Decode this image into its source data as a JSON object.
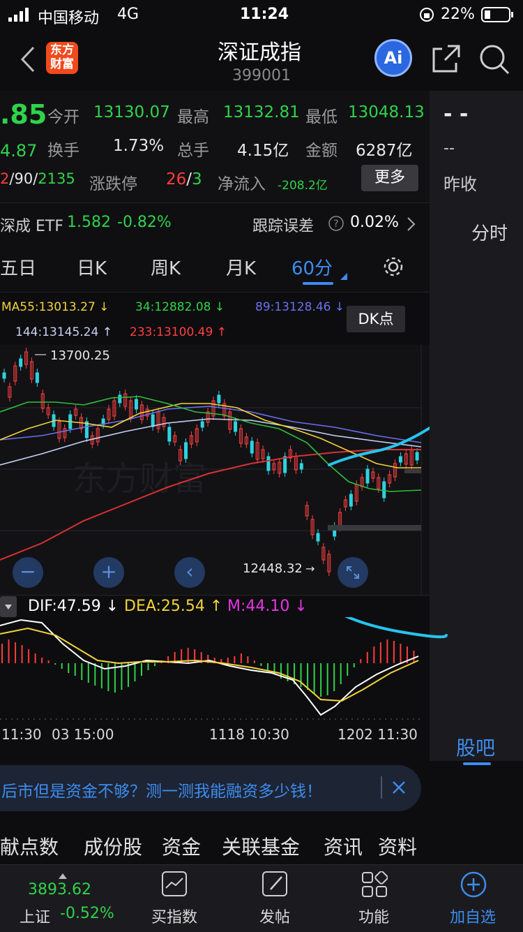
{
  "status_bar": {
    "carrier": "中国移动",
    "network": "4G",
    "time": "11:24",
    "battery": "22%"
  },
  "header": {
    "title": "深证成指",
    "code": "399001",
    "logo_text": "东方财富",
    "ai_label": "Ai"
  },
  "quote": {
    "price": ".85",
    "change": "4.87",
    "open_label": "今开",
    "open_value": "13130.07",
    "high_label": "最高",
    "high_value": "13132.81",
    "low_label": "最低",
    "low_value": "13048.13",
    "turnover_label": "换手",
    "turnover_value": "1.73%",
    "volume_label": "总手",
    "volume_value": "4.15亿",
    "amount_label": "金额",
    "amount_value": "6287亿",
    "breadth_up": "2",
    "breadth_flat": "90",
    "breadth_down": "2135",
    "limit_label": "涨跌停",
    "limit_up": "26",
    "limit_down": "3",
    "netflow_label": "净流入",
    "netflow_value": "-208.2亿",
    "more_label": "更多",
    "side_dash_top": "- -",
    "side_dash_mid": "--",
    "side_prev_close": "昨收"
  },
  "etf": {
    "label": "深成 ETF",
    "price": "1.582",
    "change": "-0.82%",
    "track_label": "跟踪误差",
    "track_value": "0.02%"
  },
  "tabs": [
    "五日",
    "日K",
    "周K",
    "月K",
    "60分"
  ],
  "side_tabs": {
    "timeshare": "分时",
    "guba": "股吧"
  },
  "ma_legend": {
    "ma55": "MA55:13013.27",
    "ma34": "34:12882.08",
    "ma89": "89:13128.46",
    "ma144": "144:13145.24",
    "ma233": "233:13100.49",
    "dk": "DK点"
  },
  "chart_labels": {
    "high_mark": "13700.25",
    "low_mark": "12448.32",
    "watermark": "东方财富"
  },
  "macd": {
    "dif": "DIF:47.59",
    "dea": "DEA:25.54",
    "m": "M:44.10"
  },
  "time_axis": [
    "11:30",
    "03 15:00",
    "1118 10:30",
    "1202 11:30"
  ],
  "banner": {
    "text": "后市但是资金不够？测一测我能融资多少钱！"
  },
  "bottom_tabs": [
    "献点数",
    "成份股",
    "资金",
    "关联基金",
    "资讯",
    "资料"
  ],
  "navbar": {
    "index_value": "3893.62",
    "index_name": "上证",
    "index_change": "-0.52%",
    "items": [
      "买指数",
      "发帖",
      "功能",
      "加自选"
    ]
  }
}
